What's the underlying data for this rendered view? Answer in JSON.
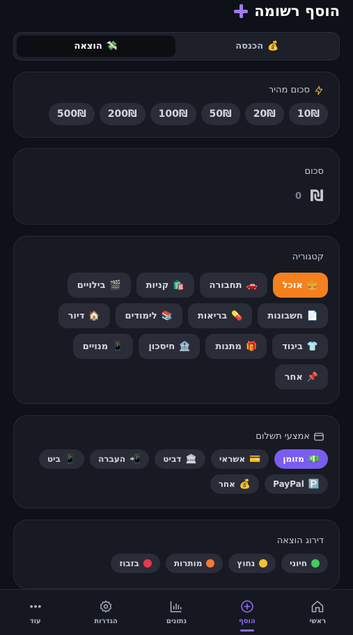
{
  "header": {
    "title": "הוסף רשומה"
  },
  "type_toggle": {
    "income": {
      "label": "הכנסה",
      "icon": "💰"
    },
    "expense": {
      "label": "הוצאה",
      "icon": "💸",
      "active": true
    }
  },
  "quick_amount": {
    "label": "סכום מהיר",
    "options": [
      "10₪",
      "20₪",
      "50₪",
      "100₪",
      "200₪",
      "500₪"
    ]
  },
  "amount": {
    "label": "סכום",
    "currency_symbol": "₪",
    "value": "0"
  },
  "category": {
    "label": "קטגוריה",
    "items": [
      {
        "icon": "🍔",
        "label": "אוכל",
        "active": true
      },
      {
        "icon": "🚗",
        "label": "תחבורה"
      },
      {
        "icon": "🛍️",
        "label": "קניות"
      },
      {
        "icon": "🎬",
        "label": "בילויים"
      },
      {
        "icon": "📄",
        "label": "חשבונות"
      },
      {
        "icon": "💊",
        "label": "בריאות"
      },
      {
        "icon": "📚",
        "label": "לימודים"
      },
      {
        "icon": "🏠",
        "label": "דיור"
      },
      {
        "icon": "👕",
        "label": "ביגוד"
      },
      {
        "icon": "🎁",
        "label": "מתנות"
      },
      {
        "icon": "🏦",
        "label": "חיסכון"
      },
      {
        "icon": "📱",
        "label": "מנויים"
      },
      {
        "icon": "📌",
        "label": "אחר"
      }
    ]
  },
  "payment": {
    "label": "אמצעי תשלום",
    "items": [
      {
        "icon": "💵",
        "label": "מזומן",
        "active": true
      },
      {
        "icon": "💳",
        "label": "אשראי"
      },
      {
        "icon": "🏛",
        "label": "דביט"
      },
      {
        "icon": "📲",
        "label": "העברה"
      },
      {
        "icon": "📱",
        "label": "ביט"
      },
      {
        "icon": "🅿️",
        "label": "PayPal"
      },
      {
        "icon": "💰",
        "label": "אחר"
      }
    ]
  },
  "rating": {
    "label": "דירוג הוצאה",
    "items": [
      {
        "label": "חיוני",
        "color": "#3ecf5c"
      },
      {
        "label": "נחוץ",
        "color": "#f2c230"
      },
      {
        "label": "מותרות",
        "color": "#f57a35"
      },
      {
        "label": "בזבוז",
        "color": "#e8384a"
      }
    ]
  },
  "nav": {
    "home": "ראשי",
    "add": "הוסף",
    "stats": "נתונים",
    "settings": "הגדרות",
    "more": "עוד"
  },
  "colors": {
    "accent": "#7a5cf0",
    "active_category": "#f7801e"
  }
}
